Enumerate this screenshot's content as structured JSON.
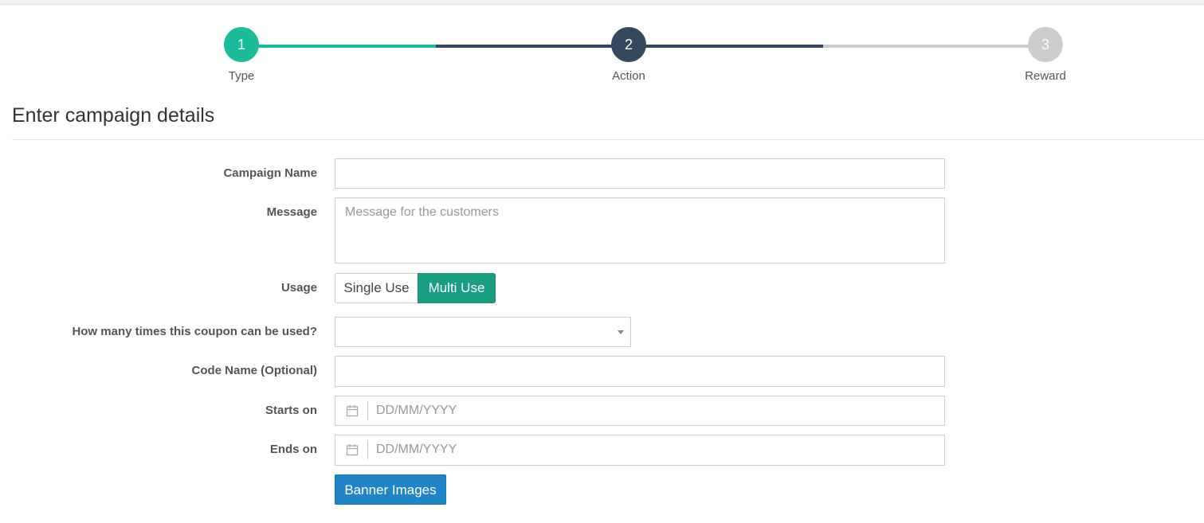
{
  "stepper": {
    "steps": [
      {
        "number": "1",
        "label": "Type",
        "state": "complete"
      },
      {
        "number": "2",
        "label": "Action",
        "state": "active"
      },
      {
        "number": "3",
        "label": "Reward",
        "state": "pending"
      }
    ],
    "colors": {
      "complete": "#1abc9c",
      "active": "#34495e",
      "pending": "#cccccc"
    }
  },
  "page": {
    "title": "Enter campaign details"
  },
  "form": {
    "campaign_name": {
      "label": "Campaign Name",
      "value": ""
    },
    "message": {
      "label": "Message",
      "placeholder": "Message for the customers",
      "value": ""
    },
    "usage": {
      "label": "Usage",
      "options": [
        "Single Use",
        "Multi Use"
      ],
      "selected": "Multi Use"
    },
    "coupon_uses": {
      "label": "How many times this coupon can be used?",
      "value": ""
    },
    "code_name": {
      "label": "Code Name (Optional)",
      "value": ""
    },
    "starts_on": {
      "label": "Starts on",
      "placeholder": "DD/MM/YYYY",
      "icon": "calendar-icon"
    },
    "ends_on": {
      "label": "Ends on",
      "placeholder": "DD/MM/YYYY",
      "icon": "calendar-icon"
    },
    "banner_button": {
      "label": "Banner Images"
    }
  },
  "accent": {
    "primary_button": "#2184c6",
    "toggle_active": "#1a9e82"
  }
}
